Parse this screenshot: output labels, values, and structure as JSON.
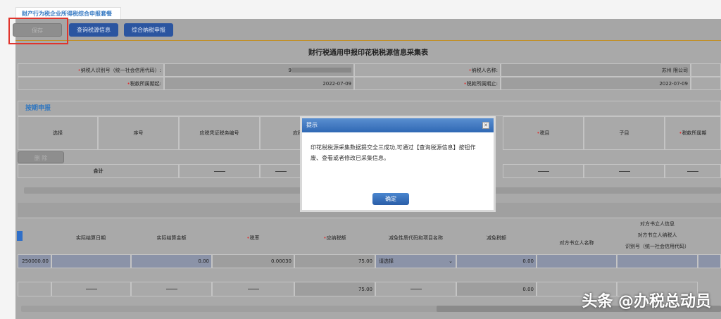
{
  "tab": {
    "label": "财产行为税企业所得税综合申报套餐"
  },
  "toolbar": {
    "save": "保存",
    "query": "查询税源信息",
    "declare": "综合纳税申报"
  },
  "title": "财行税通用申报印花税税源信息采集表",
  "info": {
    "taxpayer_id_label": "纳税人识别号（统一社会信用代码）:",
    "taxpayer_id_value": "9",
    "taxpayer_name_label": "纳税人名称:",
    "taxpayer_name_value": "苏州               限公司",
    "period_start_label": "税款所属期起:",
    "period_start_value": "2022-07-09",
    "period_end_label": "税款所属期止:",
    "period_end_value": "2022-07-09"
  },
  "section": {
    "title": "按期申报",
    "headers": [
      "选择",
      "序号",
      "应税凭证税务编号",
      "应税凭",
      "税目",
      "子目",
      "税款所属期"
    ],
    "delete": "删 除",
    "total": "合计"
  },
  "table2": {
    "headers": [
      "实际结算日期",
      "实际结算金额",
      "税率",
      "应纳税额",
      "减免性质代码和项目名称",
      "减免税额",
      "对方书立人名称"
    ],
    "group_header": "对方书立人信息",
    "id_header_1": "对方书立人纳税人",
    "id_header_2": "识别号（统一社会信用代码）",
    "row": {
      "amount": "250000.00",
      "settled_amount": "0.00",
      "rate": "0.00030",
      "tax": "75.00",
      "reduction_select": "请选择",
      "reduction_amount": "0.00"
    },
    "total": {
      "tax": "75.00",
      "reduction_amount": "0.00"
    }
  },
  "modal": {
    "title": "提示",
    "message": "印花税税源采集数据提交全三成功,可通过【查询税源信息】按钮作废、查看或者修改已采集信息。",
    "ok": "确定"
  },
  "watermark": "头条 @办税总动员",
  "colors": {
    "accent": "#2b55a0",
    "highlight": "#e0342c"
  }
}
